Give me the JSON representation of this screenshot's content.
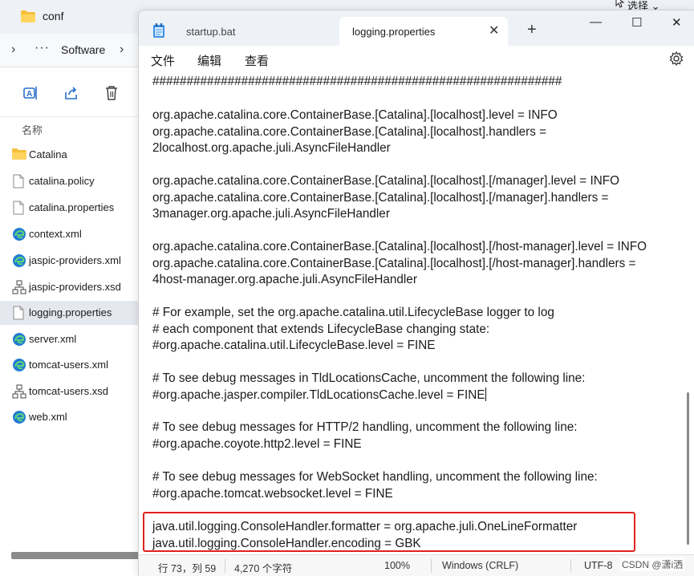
{
  "explorer": {
    "title": "conf",
    "select_label": "选择",
    "breadcrumb": {
      "dots": "···",
      "folder": "Software"
    },
    "column_header": "名称",
    "files": [
      {
        "name": "Catalina",
        "icon": "folder-icon"
      },
      {
        "name": "catalina.policy",
        "icon": "file-icon"
      },
      {
        "name": "catalina.properties",
        "icon": "file-icon"
      },
      {
        "name": "context.xml",
        "icon": "edge-icon"
      },
      {
        "name": "jaspic-providers.xml",
        "icon": "edge-icon"
      },
      {
        "name": "jaspic-providers.xsd",
        "icon": "xsd-icon"
      },
      {
        "name": "logging.properties",
        "icon": "file-icon",
        "selected": true
      },
      {
        "name": "server.xml",
        "icon": "edge-icon"
      },
      {
        "name": "tomcat-users.xml",
        "icon": "edge-icon"
      },
      {
        "name": "tomcat-users.xsd",
        "icon": "xsd-icon"
      },
      {
        "name": "web.xml",
        "icon": "edge-icon"
      }
    ]
  },
  "notepad": {
    "tabs": [
      {
        "label": "startup.bat",
        "active": false
      },
      {
        "label": "logging.properties",
        "active": true
      }
    ],
    "menu": {
      "file": "文件",
      "edit": "编辑",
      "view": "查看"
    },
    "lines": {
      "l0": "############################################################",
      "l1": "org.apache.catalina.core.ContainerBase.[Catalina].[localhost].level = INFO",
      "l2": "org.apache.catalina.core.ContainerBase.[Catalina].[localhost].handlers =",
      "l3": "2localhost.org.apache.juli.AsyncFileHandler",
      "l4": "org.apache.catalina.core.ContainerBase.[Catalina].[localhost].[/manager].level = INFO",
      "l5": "org.apache.catalina.core.ContainerBase.[Catalina].[localhost].[/manager].handlers =",
      "l6": "3manager.org.apache.juli.AsyncFileHandler",
      "l7": "org.apache.catalina.core.ContainerBase.[Catalina].[localhost].[/host-manager].level = INFO",
      "l8": "org.apache.catalina.core.ContainerBase.[Catalina].[localhost].[/host-manager].handlers =",
      "l9": "4host-manager.org.apache.juli.AsyncFileHandler",
      "l10": "# For example, set the org.apache.catalina.util.LifecycleBase logger to log",
      "l11": "# each component that extends LifecycleBase changing state:",
      "l12": "#org.apache.catalina.util.LifecycleBase.level = FINE",
      "l13": "# To see debug messages in TldLocationsCache, uncomment the following line:",
      "l14": "#org.apache.jasper.compiler.TldLocationsCache.level = FINE",
      "l15": "# To see debug messages for HTTP/2 handling, uncomment the following line:",
      "l16": "#org.apache.coyote.http2.level = FINE",
      "l17": "# To see debug messages for WebSocket handling, uncomment the following line:",
      "l18": "#org.apache.tomcat.websocket.level = FINE",
      "l19": "java.util.logging.ConsoleHandler.formatter = org.apache.juli.OneLineFormatter",
      "l20": "java.util.logging.ConsoleHandler.encoding = GBK"
    },
    "status": {
      "position": "行 73，列 59",
      "char_count": "4,270 个字符",
      "zoom": "100%",
      "line_ending": "Windows (CRLF)",
      "encoding": "UTF-8"
    },
    "colors": {
      "highlight": "#e0211c",
      "accent": "#0067c0"
    }
  },
  "watermark": "CSDN @潇i洒"
}
